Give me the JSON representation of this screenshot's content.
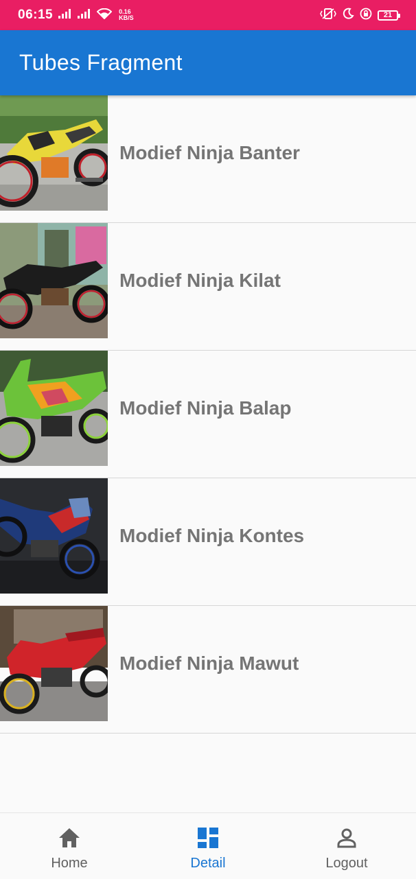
{
  "status_bar": {
    "time": "06:15",
    "speed_value": "0.16",
    "speed_unit": "KB/S",
    "battery": "21",
    "color": "#e91e63"
  },
  "app_bar": {
    "title": "Tubes Fragment",
    "color": "#1976d2"
  },
  "list": {
    "items": [
      {
        "title": "Modief Ninja Banter",
        "icon": "motorcycle-photo-yellow"
      },
      {
        "title": "Modief Ninja Kilat",
        "icon": "motorcycle-photo-black"
      },
      {
        "title": "Modief Ninja Balap",
        "icon": "motorcycle-photo-green"
      },
      {
        "title": "Modief Ninja Kontes",
        "icon": "motorcycle-photo-blue"
      },
      {
        "title": "Modief Ninja Mawut",
        "icon": "motorcycle-photo-red"
      }
    ]
  },
  "bottom_nav": {
    "items": [
      {
        "label": "Home",
        "icon": "home-icon",
        "active": false
      },
      {
        "label": "Detail",
        "icon": "dashboard-icon",
        "active": true
      },
      {
        "label": "Logout",
        "icon": "person-icon",
        "active": false
      }
    ],
    "active_color": "#1976d2"
  }
}
